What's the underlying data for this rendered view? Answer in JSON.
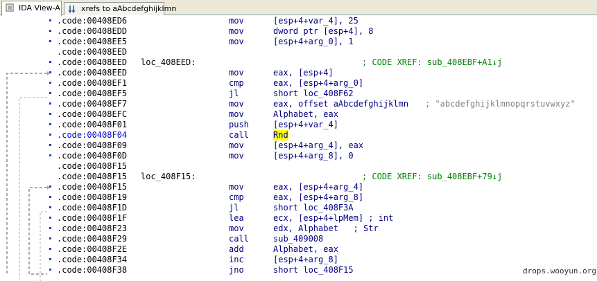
{
  "tabs": [
    {
      "label": "IDA View-A",
      "icon": "ida-view-icon",
      "active": true
    },
    {
      "label": "xrefs to aAbcdefghijklmn",
      "icon": "xrefs-icon",
      "active": false
    }
  ],
  "lines": [
    {
      "addr": ".code:00408ED6",
      "mn": "mov",
      "op": "[esp+4+var_4], 25",
      "dot": true
    },
    {
      "addr": ".code:00408EDD",
      "mn": "mov",
      "op": "dword ptr [esp+4], 8",
      "dot": true
    },
    {
      "addr": ".code:00408EE5",
      "mn": "mov",
      "op": "[esp+4+arg_0], 1",
      "dot": true
    },
    {
      "addr": ".code:00408EED",
      "dot": false
    },
    {
      "addr": ".code:00408EED",
      "label": "loc_408EED:",
      "comment": "; CODE XREF: sub_408EBF+A1↓j",
      "dot": true
    },
    {
      "addr": ".code:00408EED",
      "mn": "mov",
      "op": "eax, [esp+4]",
      "dot": true
    },
    {
      "addr": ".code:00408EF1",
      "mn": "cmp",
      "op": "eax, [esp+4+arg_0]",
      "dot": true
    },
    {
      "addr": ".code:00408EF5",
      "mn": "jl",
      "op": "short loc_408F62",
      "dot": true
    },
    {
      "addr": ".code:00408EF7",
      "mn": "mov",
      "op": "eax, offset aAbcdefghijklmn",
      "str": "; \"abcdefghijklmnopqrstuvwxyz\"",
      "dot": true
    },
    {
      "addr": ".code:00408EFC",
      "mn": "mov",
      "op": "Alphabet, eax",
      "dot": true
    },
    {
      "addr": ".code:00408F01",
      "mn": "push",
      "op": "[esp+4+var_4]",
      "dot": true
    },
    {
      "addr": ".code:00408F04",
      "mn": "call",
      "op": "Rnd",
      "dot": true,
      "selected": true,
      "highlight": true
    },
    {
      "addr": ".code:00408F09",
      "mn": "mov",
      "op": "[esp+4+arg_4], eax",
      "dot": true
    },
    {
      "addr": ".code:00408F0D",
      "mn": "mov",
      "op": "[esp+4+arg_8], 0",
      "dot": true
    },
    {
      "addr": ".code:00408F15",
      "dot": false
    },
    {
      "addr": ".code:00408F15",
      "label": "loc_408F15:",
      "comment": "; CODE XREF: sub_408EBF+79↓j",
      "dot": false
    },
    {
      "addr": ".code:00408F15",
      "mn": "mov",
      "op": "eax, [esp+4+arg_4]",
      "dot": true
    },
    {
      "addr": ".code:00408F19",
      "mn": "cmp",
      "op": "eax, [esp+4+arg_8]",
      "dot": true
    },
    {
      "addr": ".code:00408F1D",
      "mn": "jl",
      "op": "short loc_408F3A",
      "dot": true
    },
    {
      "addr": ".code:00408F1F",
      "mn": "lea",
      "op": "ecx, [esp+4+lpMem] ; int",
      "dot": true
    },
    {
      "addr": ".code:00408F23",
      "mn": "mov",
      "op": "edx, Alphabet   ; Str",
      "dot": true
    },
    {
      "addr": ".code:00408F29",
      "mn": "call",
      "op": "sub_409008",
      "dot": true
    },
    {
      "addr": ".code:00408F2E",
      "mn": "add",
      "op": "Alphabet, eax",
      "dot": true
    },
    {
      "addr": ".code:00408F34",
      "mn": "inc",
      "op": "[esp+4+arg_8]",
      "dot": true
    },
    {
      "addr": ".code:00408F38",
      "mn": "jno",
      "op": "short loc_408F15",
      "dot": true
    }
  ],
  "watermark": "drops.wooyun.org"
}
